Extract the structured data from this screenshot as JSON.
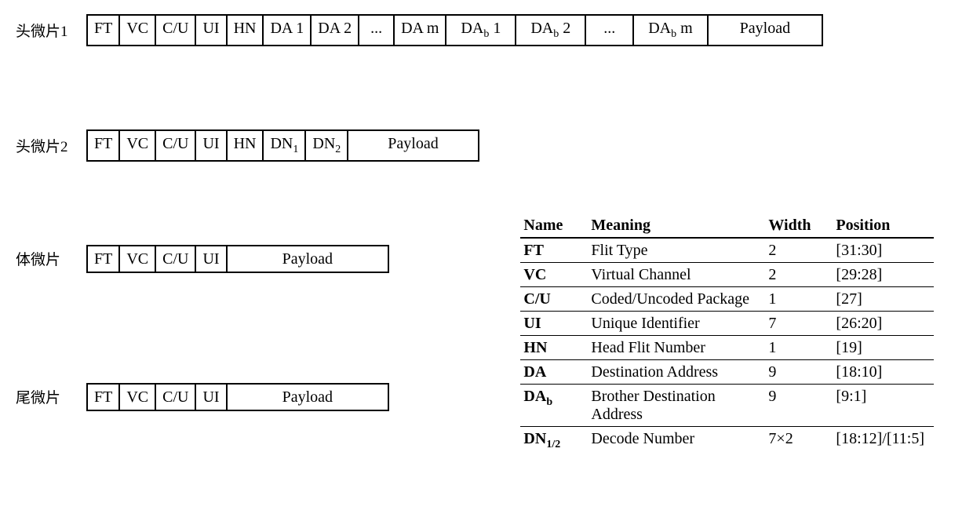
{
  "rows": {
    "head1": {
      "label": "头微片1",
      "cells": [
        "FT",
        "VC",
        "C/U",
        "UI",
        "HN",
        "DA 1",
        "DA 2",
        "...",
        "DA m",
        "DA_b 1",
        "DA_b 2",
        "...",
        "DA_b m",
        "Payload"
      ]
    },
    "head2": {
      "label": "头微片2",
      "cells": [
        "FT",
        "VC",
        "C/U",
        "UI",
        "HN",
        "DN_1",
        "DN_2",
        "Payload"
      ]
    },
    "body": {
      "label": "体微片",
      "cells": [
        "FT",
        "VC",
        "C/U",
        "UI",
        "Payload"
      ]
    },
    "tail": {
      "label": "尾微片",
      "cells": [
        "FT",
        "VC",
        "C/U",
        "UI",
        "Payload"
      ]
    }
  },
  "table": {
    "headers": [
      "Name",
      "Meaning",
      "Width",
      "Position"
    ],
    "rows": [
      {
        "name": "FT",
        "meaning": "Flit Type",
        "width": "2",
        "position": "[31:30]"
      },
      {
        "name": "VC",
        "meaning": "Virtual Channel",
        "width": "2",
        "position": "[29:28]"
      },
      {
        "name": "C/U",
        "meaning": "Coded/Uncoded Package",
        "width": "1",
        "position": "[27]"
      },
      {
        "name": "UI",
        "meaning": "Unique Identifier",
        "width": "7",
        "position": "[26:20]"
      },
      {
        "name": "HN",
        "meaning": "Head Flit Number",
        "width": "1",
        "position": "[19]"
      },
      {
        "name": "DA",
        "meaning": "Destination Address",
        "width": "9",
        "position": "[18:10]"
      },
      {
        "name": "DA_b",
        "meaning": "Brother Destination Address",
        "width": "9",
        "position": "[9:1]"
      },
      {
        "name": "DN_1/2",
        "meaning": "Decode Number",
        "width": "7×2",
        "position": "[18:12]/[11:5]"
      }
    ]
  },
  "chart_data": {
    "type": "table",
    "title": "Flit format field definitions",
    "columns": [
      "Name",
      "Meaning",
      "Width",
      "Position"
    ],
    "rows": [
      [
        "FT",
        "Flit Type",
        "2",
        "[31:30]"
      ],
      [
        "VC",
        "Virtual Channel",
        "2",
        "[29:28]"
      ],
      [
        "C/U",
        "Coded/Uncoded Package",
        "1",
        "[27]"
      ],
      [
        "UI",
        "Unique Identifier",
        "7",
        "[26:20]"
      ],
      [
        "HN",
        "Head Flit Number",
        "1",
        "[19]"
      ],
      [
        "DA",
        "Destination Address",
        "9",
        "[18:10]"
      ],
      [
        "DA_b",
        "Brother Destination Address",
        "9",
        "[9:1]"
      ],
      [
        "DN_1/2",
        "Decode Number",
        "7×2",
        "[18:12]/[11:5]"
      ]
    ],
    "flit_layouts": {
      "head_flit_1": [
        "FT",
        "VC",
        "C/U",
        "UI",
        "HN",
        "DA 1",
        "DA 2",
        "...",
        "DA m",
        "DA_b 1",
        "DA_b 2",
        "...",
        "DA_b m",
        "Payload"
      ],
      "head_flit_2": [
        "FT",
        "VC",
        "C/U",
        "UI",
        "HN",
        "DN_1",
        "DN_2",
        "Payload"
      ],
      "body_flit": [
        "FT",
        "VC",
        "C/U",
        "UI",
        "Payload"
      ],
      "tail_flit": [
        "FT",
        "VC",
        "C/U",
        "UI",
        "Payload"
      ]
    }
  }
}
